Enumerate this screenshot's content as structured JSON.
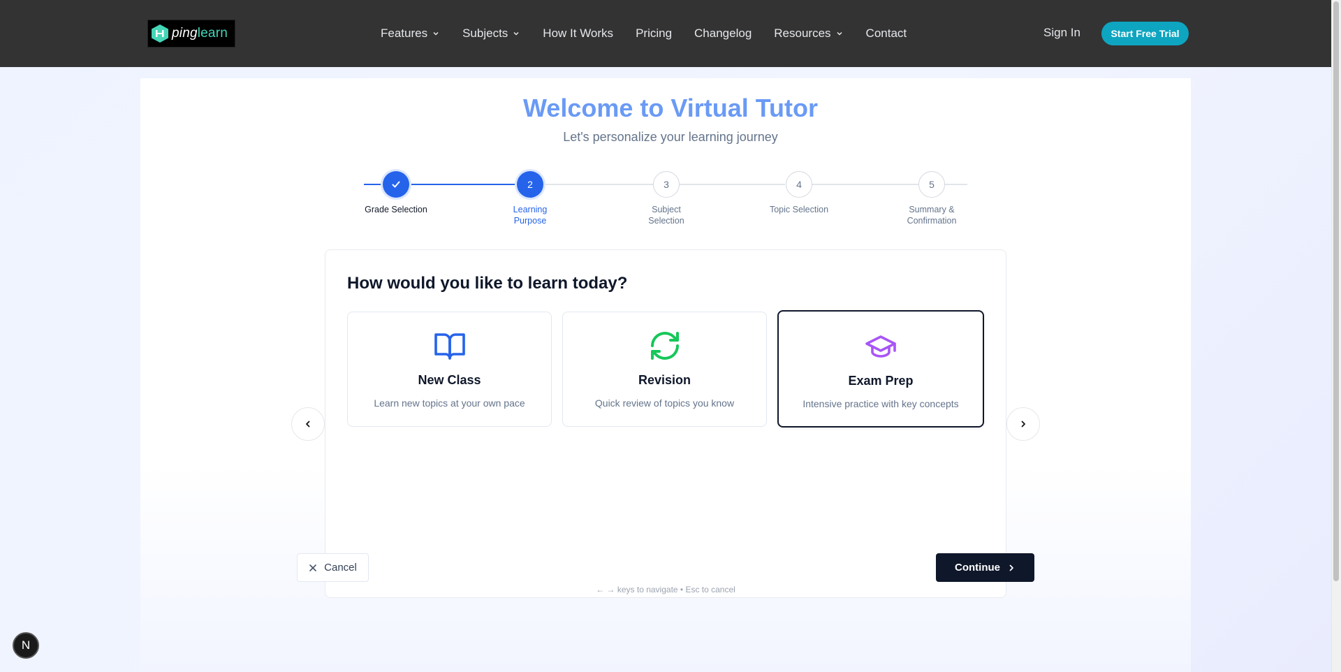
{
  "brand": {
    "name_prefix": "ping",
    "name_suffix": "learn",
    "accent_color": "#44d6b7"
  },
  "nav": {
    "items": [
      {
        "label": "Features",
        "dropdown": true
      },
      {
        "label": "Subjects",
        "dropdown": true
      },
      {
        "label": "How It Works",
        "dropdown": false
      },
      {
        "label": "Pricing",
        "dropdown": false
      },
      {
        "label": "Changelog",
        "dropdown": false
      },
      {
        "label": "Resources",
        "dropdown": true
      },
      {
        "label": "Contact",
        "dropdown": false
      }
    ],
    "signin_label": "Sign In",
    "trial_label": "Start Free Trial",
    "trial_color": "#0ea5c0"
  },
  "page": {
    "title": "Welcome to Virtual Tutor",
    "subtitle": "Let's personalize your learning journey"
  },
  "stepper": {
    "steps": [
      {
        "number": "1",
        "label": "Grade Selection",
        "state": "done"
      },
      {
        "number": "2",
        "label": "Learning Purpose",
        "state": "active"
      },
      {
        "number": "3",
        "label": "Subject Selection",
        "state": "pending"
      },
      {
        "number": "4",
        "label": "Topic Selection",
        "state": "pending"
      },
      {
        "number": "5",
        "label": "Summary & Confirmation",
        "state": "pending"
      }
    ],
    "active_color": "#2563eb"
  },
  "card": {
    "heading": "How would you like to learn today?",
    "options": [
      {
        "title": "New Class",
        "description": "Learn new topics at your own pace",
        "icon": "book-open-icon",
        "icon_color": "#2563eb",
        "selected": false
      },
      {
        "title": "Revision",
        "description": "Quick review of topics you know",
        "icon": "refresh-icon",
        "icon_color": "#16c75a",
        "selected": false
      },
      {
        "title": "Exam Prep",
        "description": "Intensive practice with key concepts",
        "icon": "graduation-cap-icon",
        "icon_color": "#a855f7",
        "selected": true
      }
    ]
  },
  "actions": {
    "cancel_label": "Cancel",
    "continue_label": "Continue"
  },
  "hint": "← → keys to navigate • Esc to cancel",
  "dev_badge": "N"
}
